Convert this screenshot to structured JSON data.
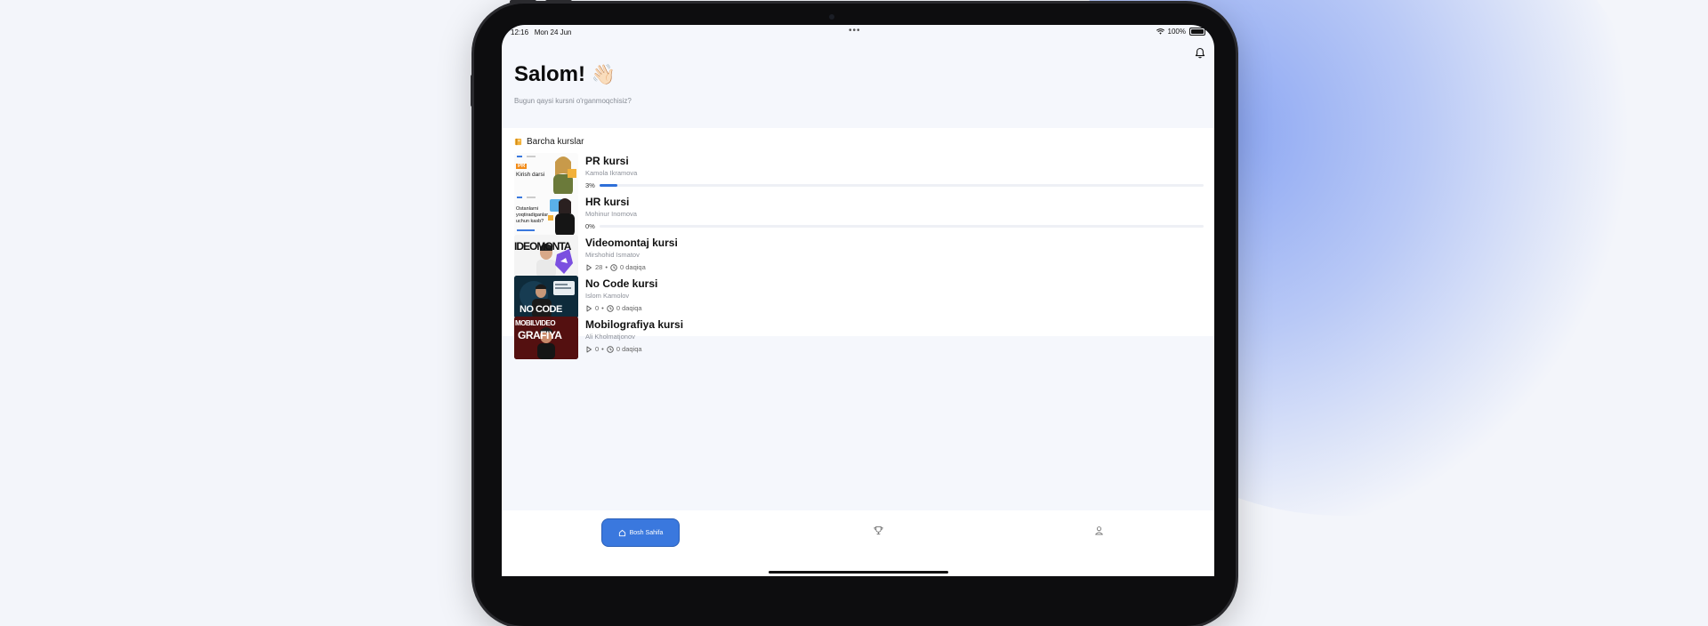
{
  "status_bar": {
    "time": "12:16",
    "date": "Mon 24 Jun",
    "battery": "100%"
  },
  "header": {
    "greeting": "Salom!",
    "greeting_emoji": "👋🏻",
    "subtitle": "Bugun qaysi kursni o'rganmoqchisiz?"
  },
  "section": {
    "title": "Barcha kurslar",
    "icon": "book-icon"
  },
  "courses": [
    {
      "title": "PR kursi",
      "author": "Kamola Ikramova",
      "progress_label": "3%",
      "progress": 0.03,
      "thumb_text": [
        "PR",
        "Kirish darsi"
      ]
    },
    {
      "title": "HR kursi",
      "author": "Mohinur Inomova",
      "progress_label": "0%",
      "progress": 0.0,
      "thumb_text": [
        "Ostanlarni",
        "yoqtiradiganlar",
        "uchun kasb?"
      ]
    },
    {
      "title": "Videomontaj kursi",
      "author": "Mirshohid Ismatov",
      "lessons": "28",
      "duration": "0 daqiqa",
      "thumb_text": [
        "IDEOMONTA"
      ]
    },
    {
      "title": "No Code kursi",
      "author": "Islom Kamolov",
      "lessons": "0",
      "duration": "0 daqiqa",
      "thumb_text": [
        "NO CODE"
      ]
    },
    {
      "title": "Mobilografiya kursi",
      "author": "Ali Kholmatjonov",
      "lessons": "0",
      "duration": "0 daqiqa",
      "thumb_text": [
        "MOBILVIDEO",
        "GRAFIYA"
      ]
    }
  ],
  "tabbar": {
    "home_label": "Bosh Sahifa",
    "tabs": [
      "home-icon",
      "trophy-icon",
      "user-icon"
    ]
  },
  "colors": {
    "accent": "#3a78de",
    "progress": "#2f6fd8"
  }
}
